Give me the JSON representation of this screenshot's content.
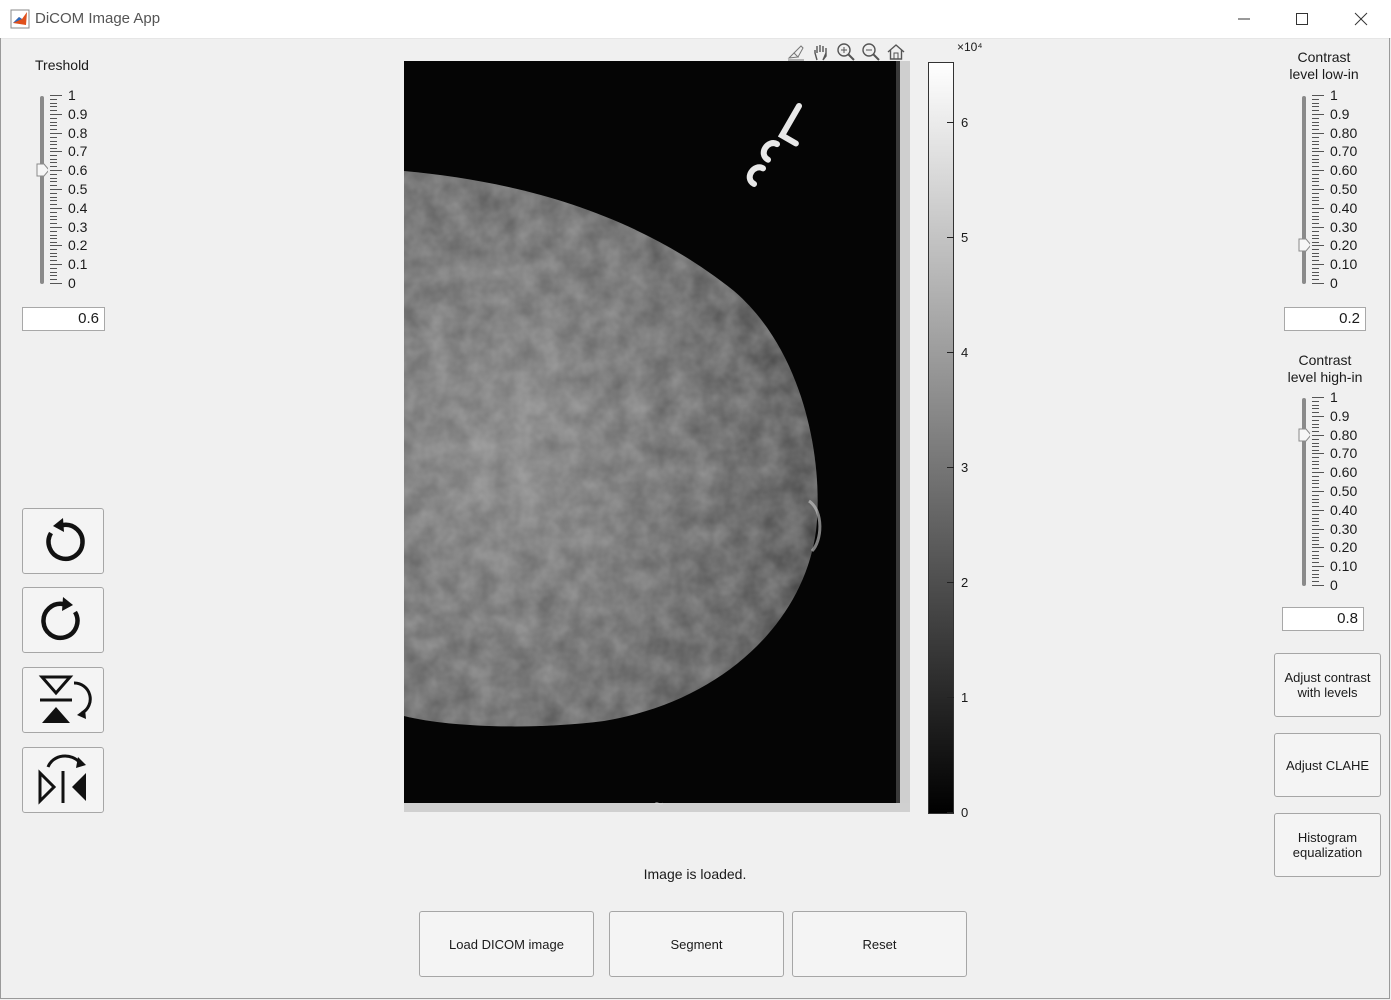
{
  "window": {
    "title": "DiCOM Image App",
    "controls": {
      "minimize": "minimize-icon",
      "maximize": "maximize-icon",
      "close": "close-icon"
    }
  },
  "threshold": {
    "label": "Treshold",
    "ticks": [
      "1",
      "0.9",
      "0.8",
      "0.7",
      "0.6",
      "0.5",
      "0.4",
      "0.3",
      "0.2",
      "0.1",
      "0"
    ],
    "value": 0.6,
    "value_text": "0.6"
  },
  "contrast_low": {
    "label_line1": "Contrast",
    "label_line2": "level low-in",
    "ticks": [
      "1",
      "0.9",
      "0.80",
      "0.70",
      "0.60",
      "0.50",
      "0.40",
      "0.30",
      "0.20",
      "0.10",
      "0"
    ],
    "value": 0.2,
    "value_text": "0.2"
  },
  "contrast_high": {
    "label_line1": "Contrast",
    "label_line2": "level high-in",
    "ticks": [
      "1",
      "0.9",
      "0.80",
      "0.70",
      "0.60",
      "0.50",
      "0.40",
      "0.30",
      "0.20",
      "0.10",
      "0"
    ],
    "value": 0.8,
    "value_text": "0.8"
  },
  "tool_buttons": [
    {
      "icon": "rotate-left-icon"
    },
    {
      "icon": "rotate-right-icon"
    },
    {
      "icon": "flip-vertical-icon"
    },
    {
      "icon": "flip-horizontal-icon"
    }
  ],
  "axes_toolbar": [
    "brush-icon",
    "pan-icon",
    "zoom-in-icon",
    "zoom-out-icon",
    "home-icon"
  ],
  "colorbar": {
    "exponent_label": "×10⁴",
    "ticks": [
      "6",
      "5",
      "4",
      "3",
      "2",
      "1",
      "0"
    ],
    "tick_values": [
      6,
      5,
      4,
      3,
      2,
      1,
      0
    ],
    "max": 6.52
  },
  "image": {
    "marker_text": "LCC"
  },
  "status_text": "Image is loaded.",
  "buttons": {
    "load": "Load DICOM image",
    "segment": "Segment",
    "reset": "Reset",
    "adjust_levels_1": "Adjust contrast",
    "adjust_levels_2": "with levels",
    "clahe": "Adjust CLAHE",
    "histeq_1": "Histogram",
    "histeq_2": "equalization"
  }
}
